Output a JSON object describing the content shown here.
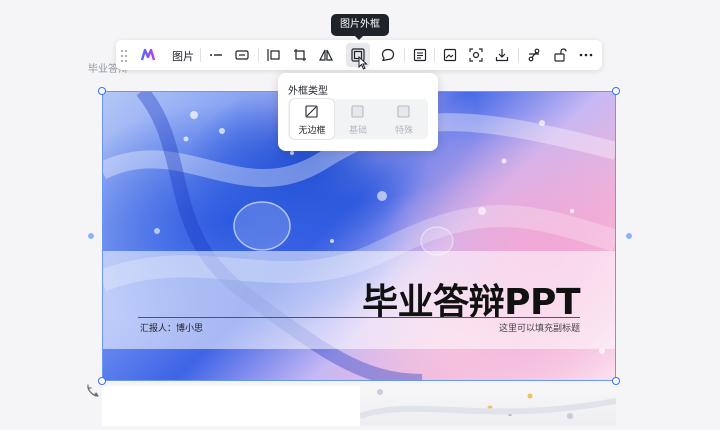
{
  "page_label": "毕业答辩",
  "toolbar": {
    "image_label": "图片",
    "tooltip": "图片外框"
  },
  "popup": {
    "title": "外框类型",
    "options": [
      {
        "label": "无边框",
        "selected": true
      },
      {
        "label": "基础",
        "selected": false
      },
      {
        "label": "特殊",
        "selected": false
      }
    ]
  },
  "slide": {
    "title": "毕业答辩PPT",
    "reporter": "汇报人：博小思",
    "subtitle": "这里可以填充副标题"
  },
  "colors": {
    "accent": "#3370ff",
    "tooltip_bg": "#1f2329",
    "selection": "#6a98f5"
  }
}
